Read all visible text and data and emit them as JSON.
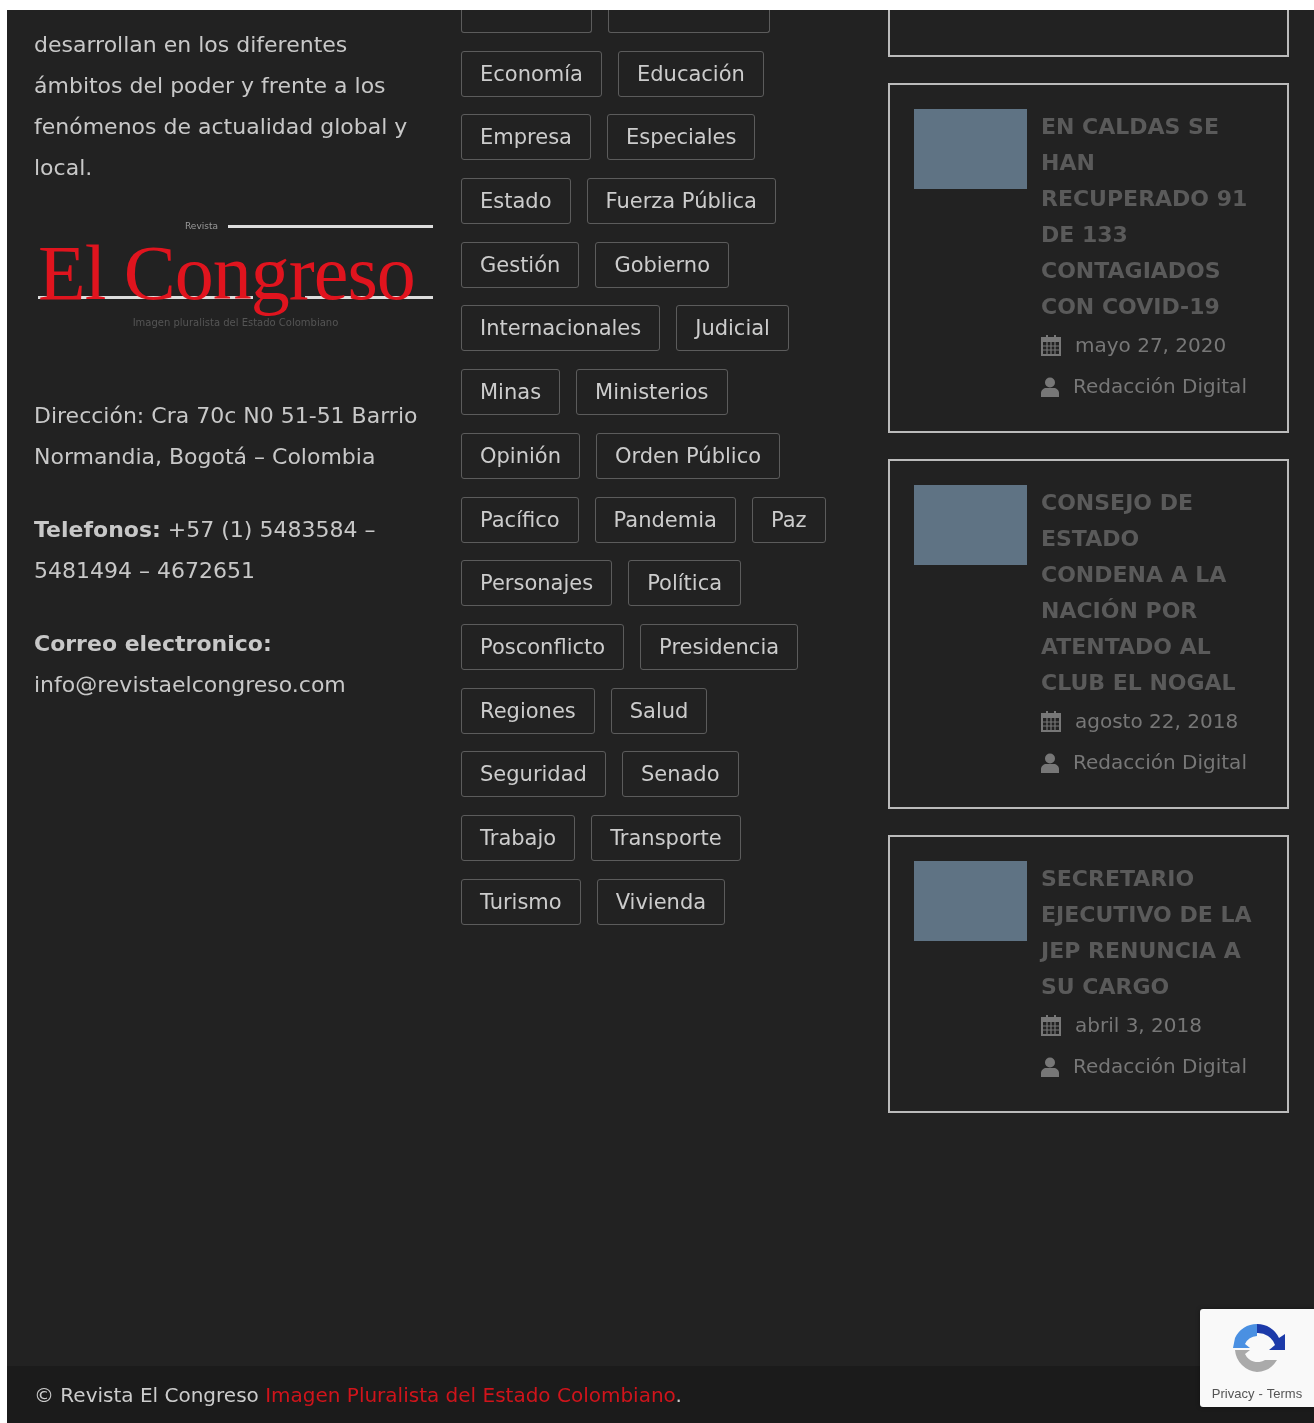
{
  "about": {
    "paragraph": "desarrollan en los diferentes ámbitos del poder y frente a los fenómenos de actualidad global y local."
  },
  "logo": {
    "wordmark": "El Congreso",
    "small_text": "Revista",
    "tagline": "Imagen pluralista del Estado Colombiano"
  },
  "contact": [
    {
      "label": "Dirección:",
      "label_bold": false,
      "value": "Cra 70c N0 51-51 Barrio Normandia, Bogotá – Colombia"
    },
    {
      "label": "Telefonos:",
      "label_bold": true,
      "value": "+57 (1) 5483584 – 5481494 – 4672651"
    },
    {
      "label": "Correo electronico:",
      "label_bold": true,
      "value": "info@revistaelcongreso.com"
    }
  ],
  "tags": [
    "Economía",
    "Educación",
    "Empresa",
    "Especiales",
    "Estado",
    "Fuerza Pública",
    "Gestión",
    "Gobierno",
    "Internacionales",
    "Judicial",
    "Minas",
    "Ministerios",
    "Opinión",
    "Orden Público",
    "Pacífico",
    "Pandemia",
    "Paz",
    "Personajes",
    "Política",
    "Posconflicto",
    "Presidencia",
    "Regiones",
    "Salud",
    "Seguridad",
    "Senado",
    "Trabajo",
    "Transporte",
    "Turismo",
    "Vivienda"
  ],
  "posts": [
    {
      "title": "EN CALDAS SE HAN RECUPERADO 91 DE 133 CONTAGIADOS CON COVID-19",
      "date": "mayo 27, 2020",
      "author": "Redacción Digital"
    },
    {
      "title": "CONSEJO DE ESTADO CONDENA A LA NACIÓN POR ATENTADO AL CLUB EL NOGAL",
      "date": "agosto 22, 2018",
      "author": "Redacción Digital"
    },
    {
      "title": "SECRETARIO EJECUTIVO DE LA JEP RENUNCIA A SU CARGO",
      "date": "abril 3, 2018",
      "author": "Redacción Digital"
    }
  ],
  "footer": {
    "text": "© Revista El Congreso",
    "link": "Imagen Pluralista del Estado Colombiano",
    "end": "."
  },
  "recaptcha": {
    "privacy": "Privacy",
    "separator": "-",
    "terms": "Terms"
  }
}
